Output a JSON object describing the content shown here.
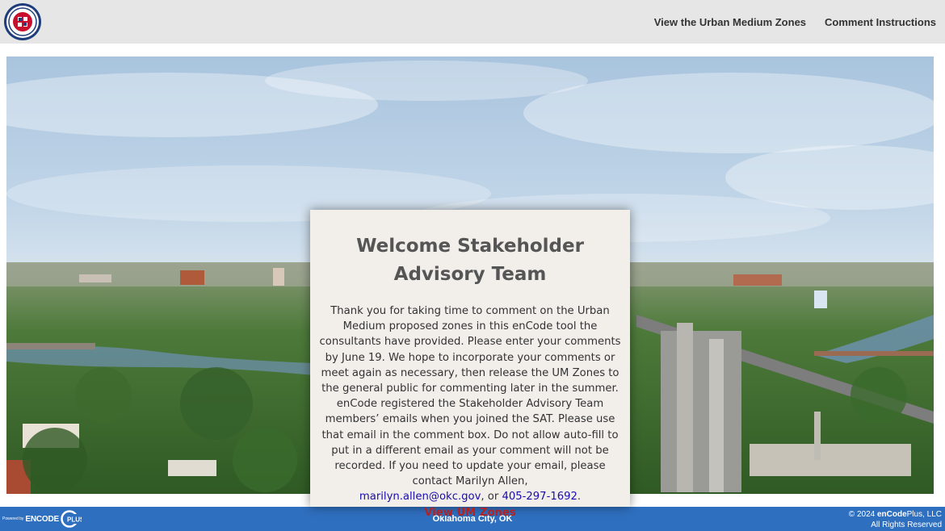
{
  "header": {
    "logo_icon": "city-seal-icon",
    "nav": [
      {
        "label": "View the Urban Medium Zones"
      },
      {
        "label": "Comment Instructions"
      }
    ]
  },
  "card": {
    "title": "Welcome Stakeholder Advisory Team",
    "paragraph1": "Thank you for taking time to comment on the Urban Medium proposed zones in this enCode tool the consultants have provided. Please enter your comments by June 19.   We hope to incorporate your comments or meet again as necessary,  then release the UM Zones to the general public for commenting later in the summer.",
    "paragraph2_text": "enCode registered the Stakeholder Advisory Team members’ emails when you joined the SAT. Please use that email in the comment box. Do not allow auto-fill to put in a different email as your comment will not be recorded. If you need to update your email, please contact Marilyn Allen,",
    "email": "marilyn.allen@okc.gov",
    "sep": ", or ",
    "phone": "405-297-1692",
    "end": ".",
    "cta_label": "View UM Zones"
  },
  "footer": {
    "powered_small": "Powered by",
    "powered_brand": "ENCODE",
    "powered_plus": "PLUS",
    "center": "Oklahoma City, OK",
    "copyright_prefix": "© 2024 ",
    "copyright_brand": "enCode",
    "copyright_suffix": "Plus, LLC",
    "rights": "All Rights Reserved"
  },
  "colors": {
    "header_bg": "#e6e6e6",
    "footer_bg": "#2f6fbf",
    "card_bg": "#f2efeb",
    "cta": "#b22222",
    "link": "#1a0dab"
  }
}
